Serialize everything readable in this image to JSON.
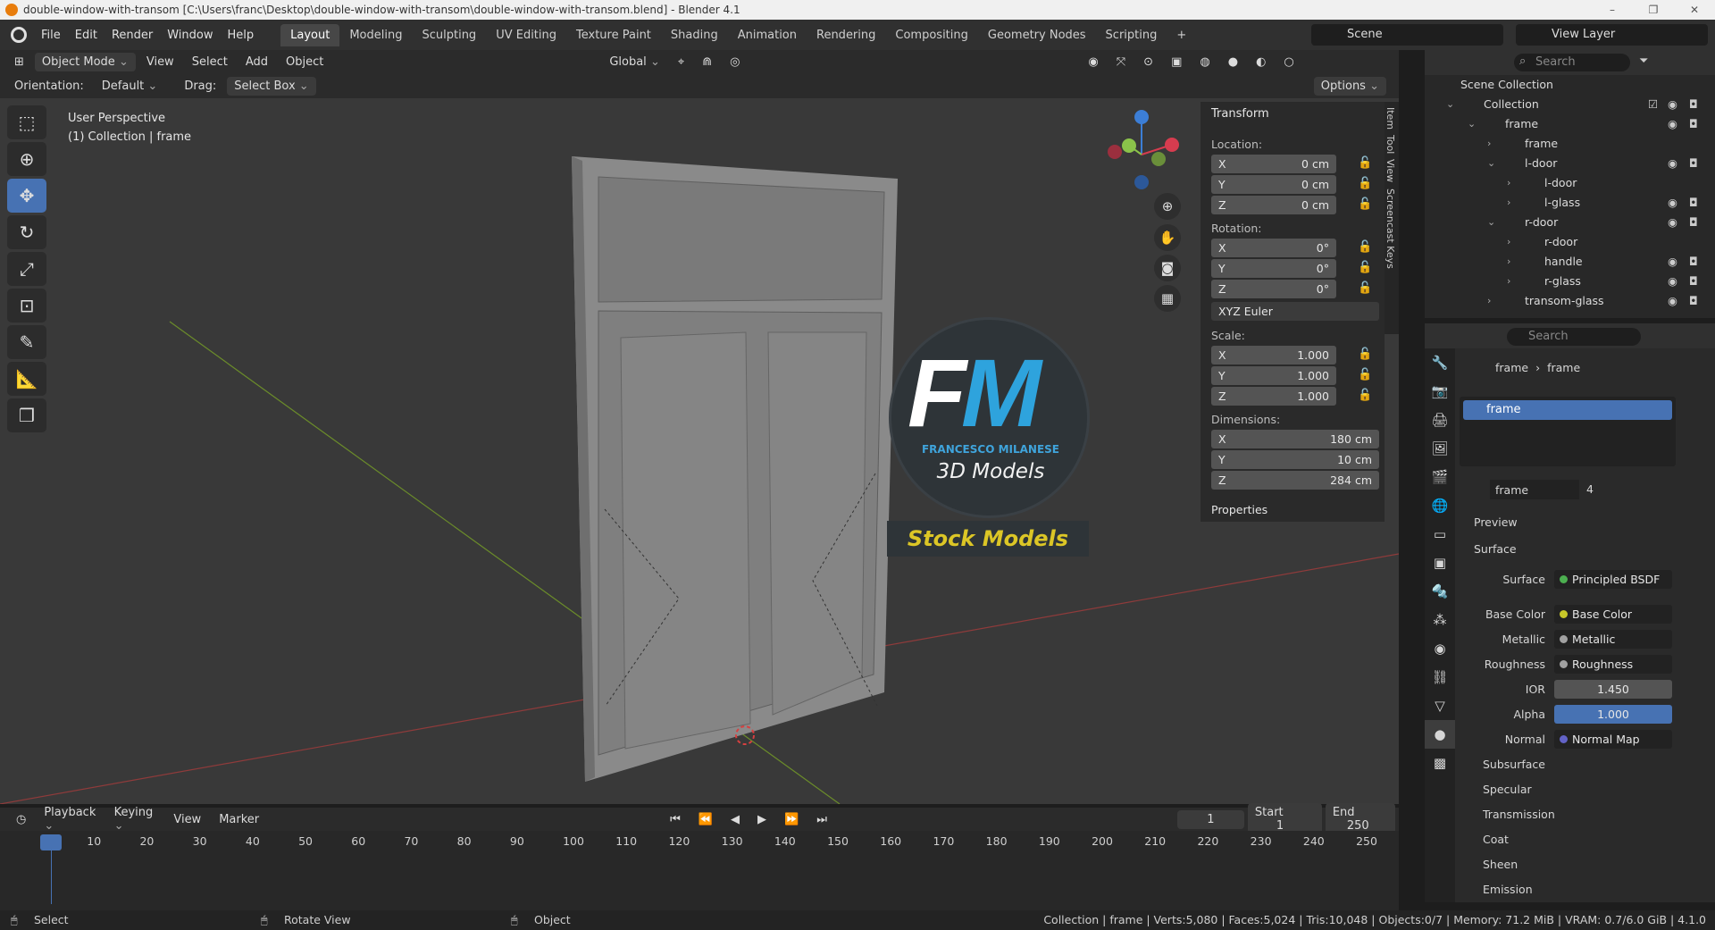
{
  "titlebar": {
    "text": "double-window-with-transom [C:\\Users\\franc\\Desktop\\double-window-with-transom\\double-window-with-transom.blend] - Blender 4.1",
    "controls": [
      "–",
      "❐",
      "✕"
    ]
  },
  "menu": [
    "File",
    "Edit",
    "Render",
    "Window",
    "Help"
  ],
  "workspaces": [
    "Layout",
    "Modeling",
    "Sculpting",
    "UV Editing",
    "Texture Paint",
    "Shading",
    "Animation",
    "Rendering",
    "Compositing",
    "Geometry Nodes",
    "Scripting",
    "+"
  ],
  "scene": "Scene",
  "view_layer": "View Layer",
  "header": {
    "mode": "Object Mode",
    "view": "View",
    "select": "Select",
    "add": "Add",
    "object": "Object",
    "transform": "Global",
    "orientation_label": "Orientation:",
    "orientation": "Default",
    "drag_label": "Drag:",
    "drag": "Select Box",
    "options": "Options"
  },
  "viewport": {
    "perspective": "User Perspective",
    "collection": "(1) Collection | frame"
  },
  "logo": {
    "fm": "FM",
    "name": "FRANCESCO MILANESE",
    "sub": "3D Models",
    "stock": "Stock Models",
    "f_color": "#ffffff",
    "m_color": "#2ea3dd"
  },
  "npanel": {
    "title": "Transform",
    "location_label": "Location:",
    "location": [
      {
        "axis": "X",
        "value": "0 cm"
      },
      {
        "axis": "Y",
        "value": "0 cm"
      },
      {
        "axis": "Z",
        "value": "0 cm"
      }
    ],
    "rotation_label": "Rotation:",
    "rotation": [
      {
        "axis": "X",
        "value": "0°"
      },
      {
        "axis": "Y",
        "value": "0°"
      },
      {
        "axis": "Z",
        "value": "0°"
      }
    ],
    "rotation_mode": "XYZ Euler",
    "scale_label": "Scale:",
    "scale": [
      {
        "axis": "X",
        "value": "1.000"
      },
      {
        "axis": "Y",
        "value": "1.000"
      },
      {
        "axis": "Z",
        "value": "1.000"
      }
    ],
    "dimensions_label": "Dimensions:",
    "dimensions": [
      {
        "axis": "X",
        "value": "180 cm"
      },
      {
        "axis": "Y",
        "value": "10 cm"
      },
      {
        "axis": "Z",
        "value": "284 cm"
      }
    ],
    "properties": "Properties",
    "tabs": [
      "Item",
      "Tool",
      "View",
      "Screencast Keys"
    ]
  },
  "outliner": {
    "search": "Search",
    "rows": [
      {
        "label": "Scene Collection"
      },
      {
        "label": "Collection"
      },
      {
        "label": "frame"
      },
      {
        "label": "frame"
      },
      {
        "label": "l-door"
      },
      {
        "label": "l-door"
      },
      {
        "label": "l-glass"
      },
      {
        "label": "r-door"
      },
      {
        "label": "r-door"
      },
      {
        "label": "handle"
      },
      {
        "label": "r-glass"
      },
      {
        "label": "transom-glass"
      }
    ]
  },
  "props": {
    "search": "Search",
    "crumb1": "frame",
    "crumb2": "frame",
    "slot": "frame",
    "material": "frame",
    "users": "4",
    "preview": "Preview",
    "surface_section": "Surface",
    "rows": [
      {
        "label": "Surface",
        "value": "Principled BSDF",
        "dot": "#4caf50"
      },
      {
        "label": "Base Color",
        "value": "Base Color",
        "dot": "#c7c729"
      },
      {
        "label": "Metallic",
        "value": "Metallic",
        "dot": "#a1a1a1"
      },
      {
        "label": "Roughness",
        "value": "Roughness",
        "dot": "#a1a1a1"
      },
      {
        "label": "IOR",
        "value": "1.450",
        "dot": "#a1a1a1"
      },
      {
        "label": "Alpha",
        "value": "1.000",
        "dot": "#a1a1a1"
      },
      {
        "label": "Normal",
        "value": "Normal Map",
        "dot": "#6363c7"
      }
    ],
    "sections": [
      "Subsurface",
      "Specular",
      "Transmission",
      "Coat",
      "Sheen",
      "Emission"
    ]
  },
  "timeline": {
    "playback": "Playback",
    "keying": "Keying",
    "view": "View",
    "marker": "Marker",
    "current": "1",
    "start_label": "Start",
    "start": "1",
    "end_label": "End",
    "end": "250",
    "ticks": [
      "1",
      "10",
      "20",
      "30",
      "40",
      "50",
      "60",
      "70",
      "80",
      "90",
      "100",
      "110",
      "120",
      "130",
      "140",
      "150",
      "160",
      "170",
      "180",
      "190",
      "200",
      "210",
      "220",
      "230",
      "240",
      "250"
    ]
  },
  "status": {
    "select": "Select",
    "rotate": "Rotate View",
    "object": "Object",
    "stats": "Collection | frame | Verts:5,080 | Faces:5,024 | Tris:10,048 | Objects:0/7 | Memory: 71.2 MiB | VRAM: 0.7/6.0 GiB | 4.1.0"
  }
}
